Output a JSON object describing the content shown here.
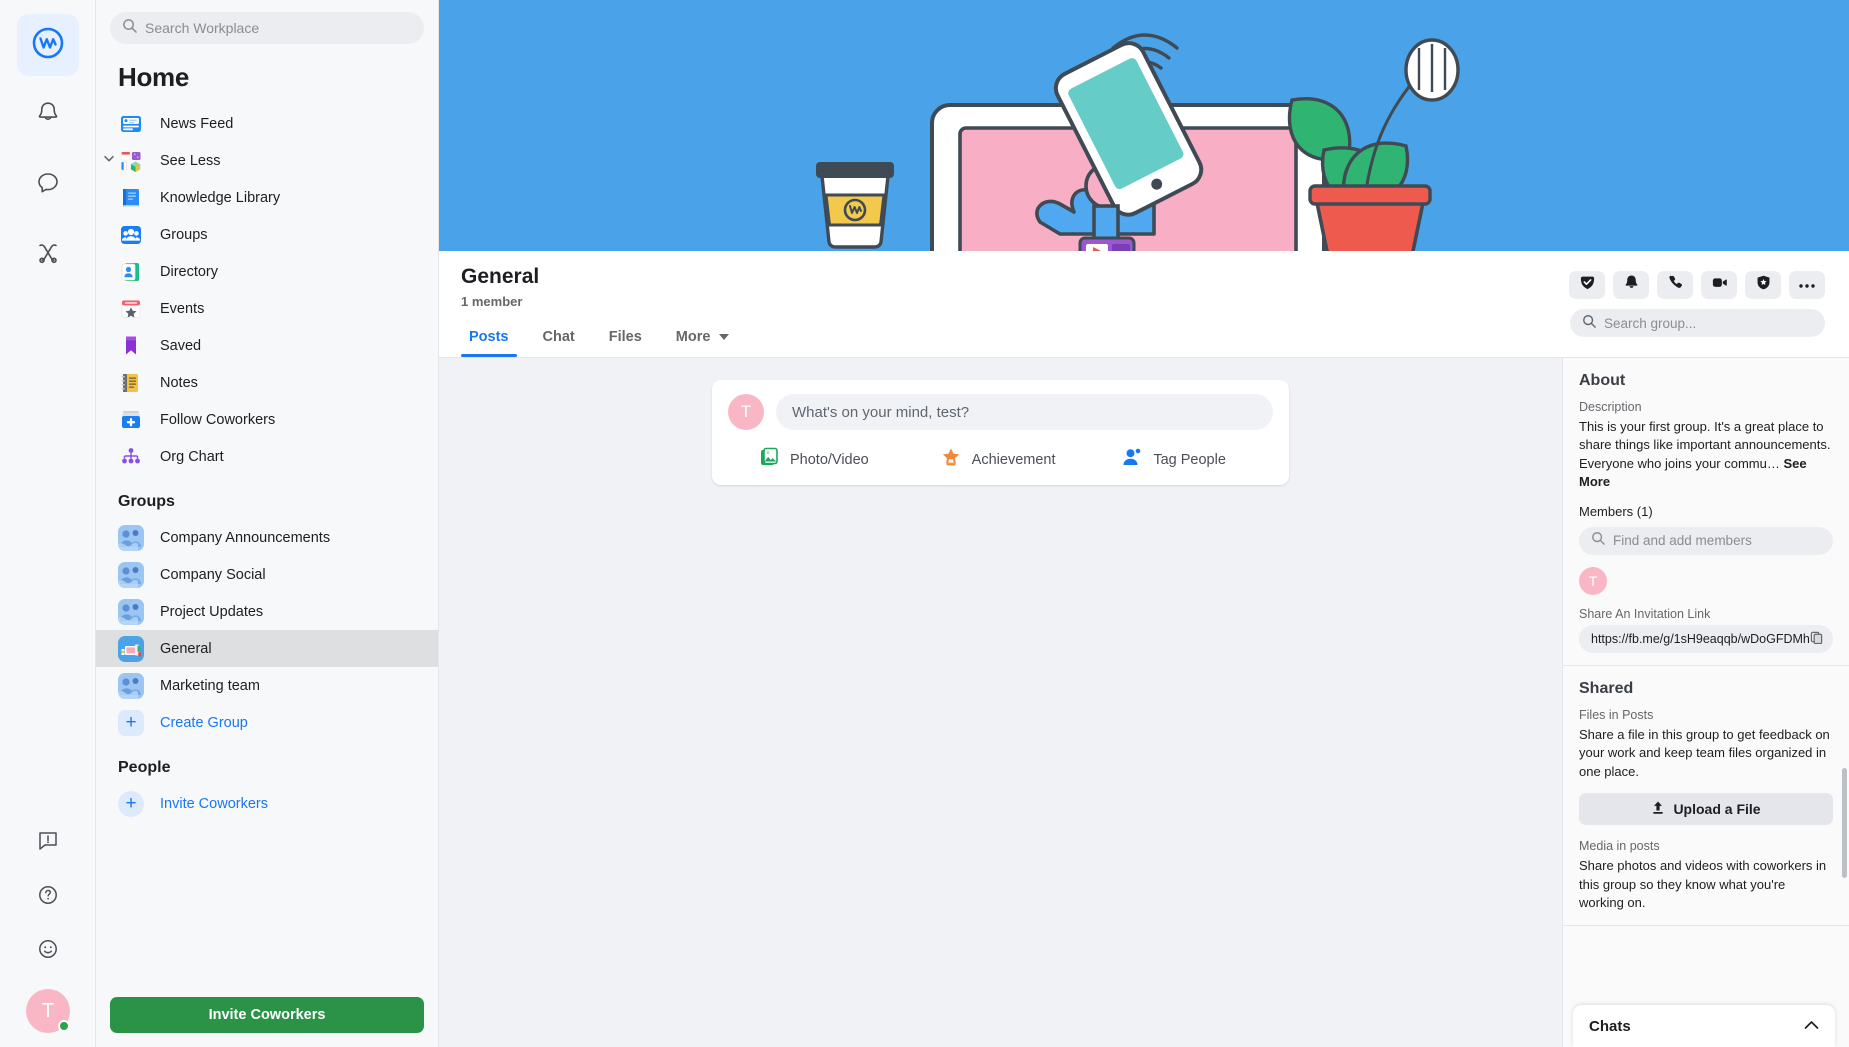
{
  "colors": {
    "brand_blue": "#1877f2",
    "cover_blue": "#4aa3e8",
    "invite_green": "#2b9348",
    "avatar_pink": "#f9b7c6"
  },
  "rail": {
    "items": [
      {
        "name": "workplace-logo",
        "icon": "workplace-icon",
        "active": true
      },
      {
        "name": "notifications",
        "icon": "bell-icon",
        "active": false
      },
      {
        "name": "chat",
        "icon": "chat-bubble-icon",
        "active": false
      },
      {
        "name": "tools",
        "icon": "wrench-tools-icon",
        "active": false
      }
    ],
    "bottom": [
      {
        "name": "feedback",
        "icon": "feedback-icon"
      },
      {
        "name": "help",
        "icon": "question-circle-icon"
      },
      {
        "name": "emoji-status",
        "icon": "smiley-icon"
      }
    ],
    "avatar_initial": "T"
  },
  "search": {
    "placeholder": "Search Workplace",
    "icon": "search-icon"
  },
  "sidebar": {
    "title": "Home",
    "items": [
      {
        "label": "News Feed",
        "icon": "news-feed-icon",
        "chevron": false
      },
      {
        "label": "See Less",
        "icon": "see-less-icon",
        "chevron": true
      },
      {
        "label": "Knowledge Library",
        "icon": "knowledge-library-icon",
        "chevron": false
      },
      {
        "label": "Groups",
        "icon": "groups-icon",
        "chevron": false
      },
      {
        "label": "Directory",
        "icon": "directory-icon",
        "chevron": false
      },
      {
        "label": "Events",
        "icon": "events-icon",
        "chevron": false
      },
      {
        "label": "Saved",
        "icon": "saved-bookmark-icon",
        "chevron": false
      },
      {
        "label": "Notes",
        "icon": "notes-icon",
        "chevron": false
      },
      {
        "label": "Follow Coworkers",
        "icon": "follow-coworkers-icon",
        "chevron": false
      },
      {
        "label": "Org Chart",
        "icon": "org-chart-icon",
        "chevron": false
      }
    ],
    "groups_heading": "Groups",
    "groups": [
      {
        "label": "Company Announcements",
        "selected": false
      },
      {
        "label": "Company Social",
        "selected": false
      },
      {
        "label": "Project Updates",
        "selected": false
      },
      {
        "label": "General",
        "selected": true
      },
      {
        "label": "Marketing team",
        "selected": false
      }
    ],
    "create_group_label": "Create Group",
    "people_heading": "People",
    "invite_coworkers_link": "Invite Coworkers",
    "invite_coworkers_button": "Invite Coworkers"
  },
  "group": {
    "name": "General",
    "members_text": "1 member",
    "tabs": [
      {
        "label": "Posts",
        "active": true
      },
      {
        "label": "Chat",
        "active": false
      },
      {
        "label": "Files",
        "active": false
      },
      {
        "label": "More",
        "active": false,
        "caret": true
      }
    ],
    "header_actions": [
      {
        "name": "archive-check-button",
        "icon": "archive-check-icon"
      },
      {
        "name": "notifications-button",
        "icon": "bell-icon"
      },
      {
        "name": "call-button",
        "icon": "phone-icon"
      },
      {
        "name": "video-call-button",
        "icon": "video-camera-icon"
      },
      {
        "name": "shield-button",
        "icon": "shield-star-icon"
      },
      {
        "name": "more-options-button",
        "icon": "ellipsis-icon"
      }
    ],
    "search_placeholder": "Search group..."
  },
  "composer": {
    "avatar_initial": "T",
    "placeholder": "What's on your mind, test?",
    "actions": [
      {
        "label": "Photo/Video",
        "icon": "photo-video-icon"
      },
      {
        "label": "Achievement",
        "icon": "achievement-star-icon"
      },
      {
        "label": "Tag People",
        "icon": "tag-people-icon"
      }
    ]
  },
  "about": {
    "heading": "About",
    "description_label": "Description",
    "description_text": "This is your first group. It's a great place to share things like important announcements. Everyone who joins your commu…",
    "see_more": "See More",
    "members_label": "Members (1)",
    "find_members_placeholder": "Find and add members",
    "member_initial": "T",
    "invite_link_label": "Share An Invitation Link",
    "invite_link_value": "https://fb.me/g/1sH9eaqqb/wDoGFDMh",
    "copy_icon": "copy-icon"
  },
  "shared": {
    "heading": "Shared",
    "files_label": "Files in Posts",
    "files_text": "Share a file in this group to get feedback on your work and keep team files organized in one place.",
    "upload_label": "Upload a File",
    "upload_icon": "upload-icon",
    "media_label": "Media in posts",
    "media_text": "Share photos and videos with coworkers in this group so they know what you're working on."
  },
  "chats": {
    "label": "Chats",
    "chevron_icon": "chevron-up-icon"
  }
}
